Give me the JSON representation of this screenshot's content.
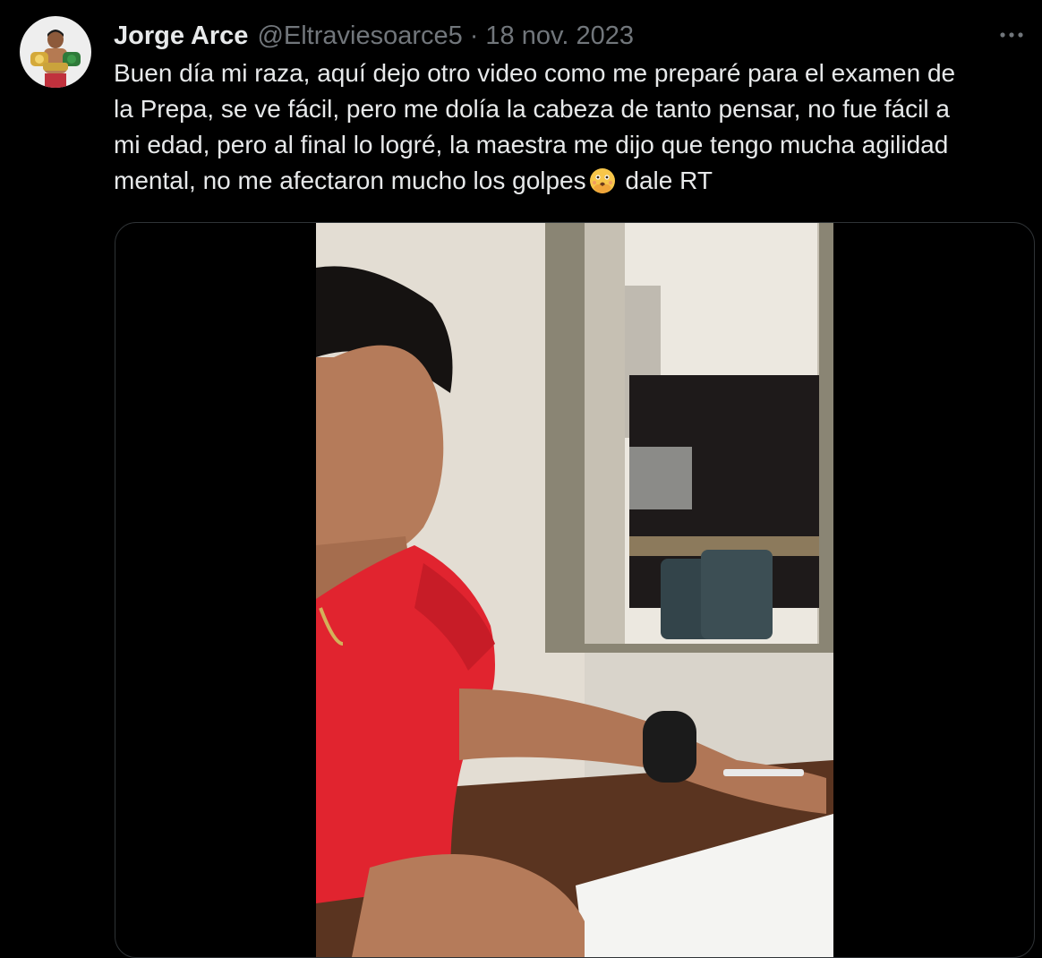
{
  "tweet": {
    "author_name": "Jorge Arce",
    "author_handle": "@Eltraviesoarce5",
    "separator": "·",
    "date": "18 nov. 2023",
    "more_icon": "more-icon",
    "text_lines": [
      "Buen día mi raza, aquí dejo otro video como me preparé para el examen de",
      "la Prepa, se ve fácil, pero me dolía la cabeza de tanto pensar, no fue fácil a",
      "mi edad, pero al final lo logré, la maestra me dijo que tengo mucha agilidad",
      "mental, no me afectaron mucho los golpes"
    ],
    "text_tail": " dale RT",
    "emoji": "face-with-open-eyes-and-hand-over-mouth"
  },
  "colors": {
    "background": "#000000",
    "text_primary": "#e7e9ea",
    "text_secondary": "#71767b",
    "border": "#2f3336"
  }
}
